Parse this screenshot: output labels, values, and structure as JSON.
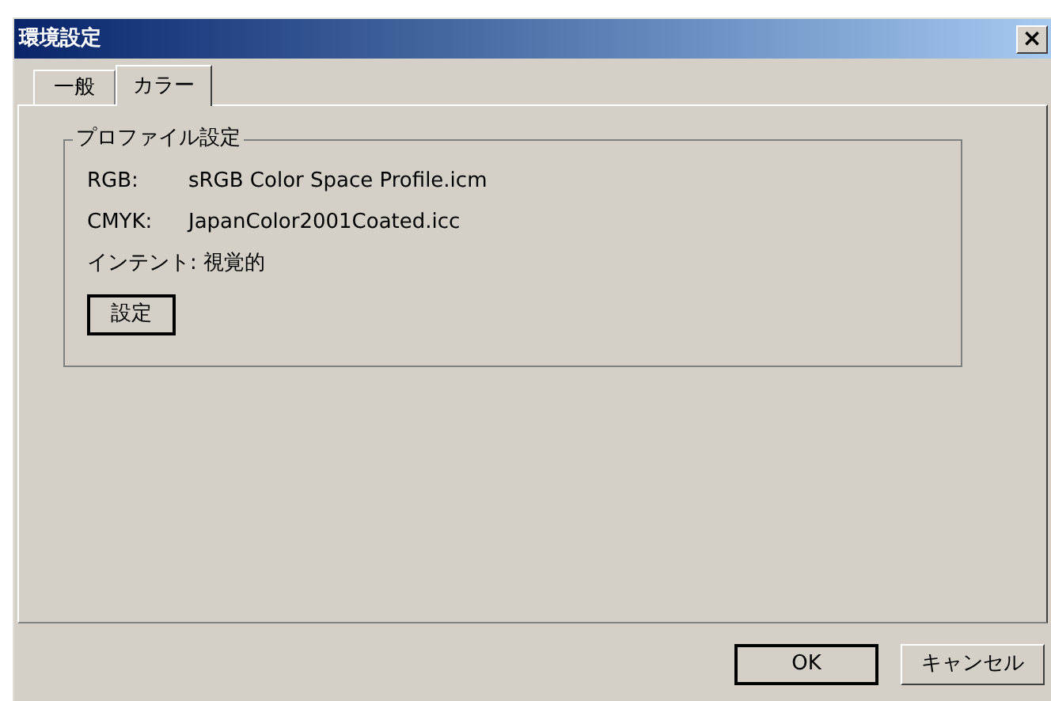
{
  "window": {
    "title": "環境設定",
    "close": "×"
  },
  "tabs": [
    {
      "label": "一般",
      "selected": false
    },
    {
      "label": "カラー",
      "selected": true
    }
  ],
  "group": {
    "title": "プロファイル設定",
    "rows": [
      {
        "label": "RGB:",
        "value": "sRGB Color Space Profile.icm"
      },
      {
        "label": "CMYK:",
        "value": "JapanColor2001Coated.icc"
      },
      {
        "label": "インテント:",
        "value": "視覚的"
      }
    ],
    "button": "設定"
  },
  "buttons": [
    {
      "label": "OK",
      "default": true
    },
    {
      "label": "キャンセル",
      "default": false
    }
  ]
}
